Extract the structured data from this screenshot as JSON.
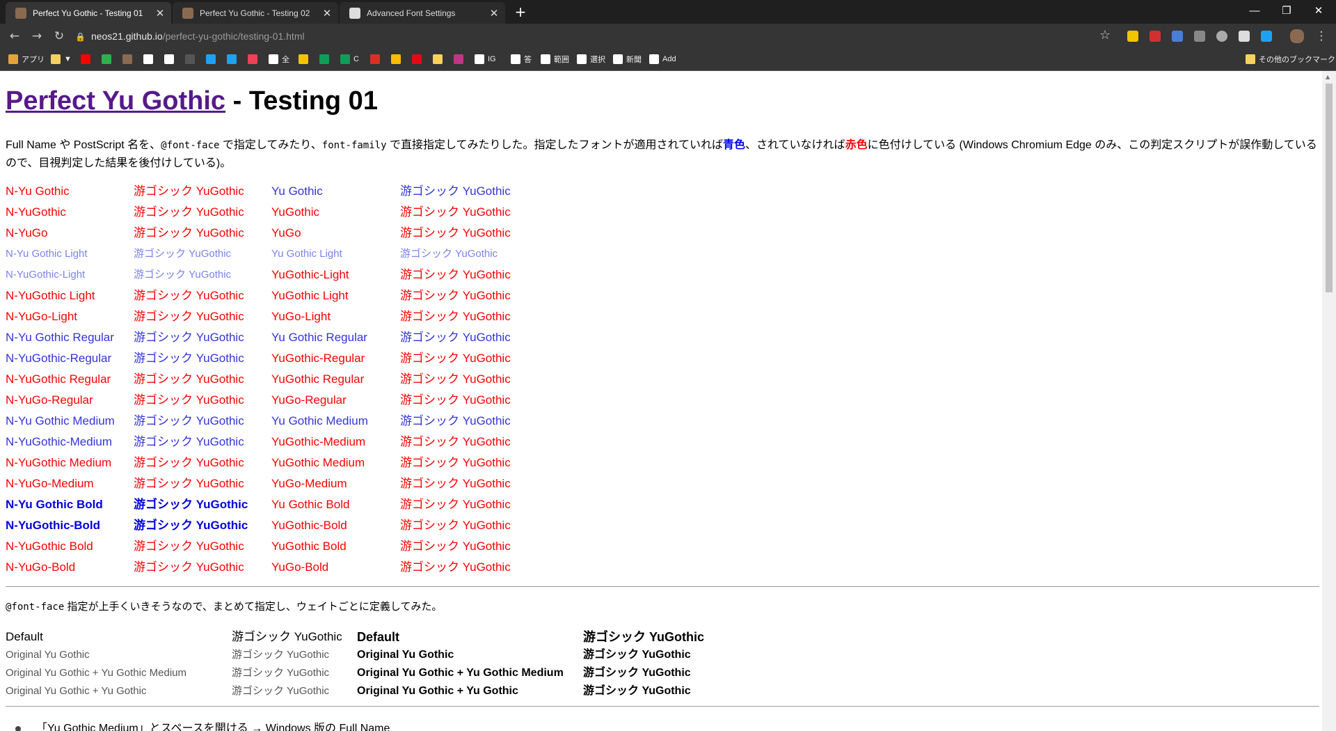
{
  "browser": {
    "tabs": [
      {
        "title": "Perfect Yu Gothic - Testing 01",
        "active": true
      },
      {
        "title": "Perfect Yu Gothic - Testing 02",
        "active": false
      },
      {
        "title": "Advanced Font Settings",
        "active": false
      }
    ],
    "new_tab": "+",
    "window_controls": {
      "minimize": "—",
      "restore": "❐",
      "close": "✕"
    },
    "nav": {
      "back": "←",
      "forward": "→",
      "reload": "↻"
    },
    "url_host": "neos21.github.io",
    "url_path": "/perfect-yu-gothic/testing-01.html",
    "bookmark_star": "☆",
    "bookmarks": [
      {
        "label": "アプリ",
        "icon": "apps-grid-icon",
        "color": "#e5a33b"
      },
      {
        "label": "▼",
        "icon": "folder-icon",
        "color": "#f6d25c"
      },
      {
        "label": "",
        "icon": "youtube-icon",
        "color": "#ff0000"
      },
      {
        "label": "",
        "icon": "feedly-icon",
        "color": "#2bb24c"
      },
      {
        "label": "",
        "icon": "photo-icon",
        "color": "#8a6a50"
      },
      {
        "label": "",
        "icon": "doc-icon",
        "color": "#ffffff"
      },
      {
        "label": "",
        "icon": "medium-icon",
        "color": "#ffffff"
      },
      {
        "label": "",
        "icon": "github-icon",
        "color": "#555555"
      },
      {
        "label": "",
        "icon": "twitter-icon",
        "color": "#1da1f2"
      },
      {
        "label": "",
        "icon": "twitter-icon",
        "color": "#1da1f2"
      },
      {
        "label": "",
        "icon": "pocket-icon",
        "color": "#ef4056"
      },
      {
        "label": "全",
        "icon": "globe-icon",
        "color": "#ffffff"
      },
      {
        "label": "",
        "icon": "note-icon",
        "color": "#f2c500"
      },
      {
        "label": "",
        "icon": "sheet-icon",
        "color": "#0f9d58"
      },
      {
        "label": "C",
        "icon": "sheet-icon",
        "color": "#0f9d58"
      },
      {
        "label": "",
        "icon": "gmail-icon",
        "color": "#d93025"
      },
      {
        "label": "",
        "icon": "drive-icon",
        "color": "#fbbc04"
      },
      {
        "label": "",
        "icon": "netflix-icon",
        "color": "#e50914"
      },
      {
        "label": "",
        "icon": "folder-icon",
        "color": "#f6d25c"
      },
      {
        "label": "",
        "icon": "instagram-icon",
        "color": "#c13584"
      },
      {
        "label": "IG",
        "icon": "globe-icon",
        "color": "#ffffff"
      },
      {
        "label": "答",
        "icon": "globe-icon",
        "color": "#ffffff"
      },
      {
        "label": "範囲",
        "icon": "globe-icon",
        "color": "#ffffff"
      },
      {
        "label": "選択",
        "icon": "globe-icon",
        "color": "#ffffff"
      },
      {
        "label": "新聞",
        "icon": "globe-icon",
        "color": "#ffffff"
      },
      {
        "label": "Add",
        "icon": "globe-icon",
        "color": "#ffffff"
      }
    ],
    "other_bookmarks": "その他のブックマーク"
  },
  "page": {
    "title_link": "Perfect Yu Gothic",
    "title_rest": " - Testing 01",
    "intro": {
      "p1": "Full Name や PostScript 名を、",
      "code1": "@font-face",
      "p2": " で指定してみたり、",
      "code2": "font-family",
      "p3": " で直接指定してみたりした。指定したフォントが適用されていれば",
      "blue": "青色",
      "p4": "、されていなければ",
      "red": "赤色",
      "p5": "に色付けしている (Windows Chromium Edge のみ、この判定スクリプトが誤作動しているので、目視判定した結果を後付けしている)。"
    },
    "rows": [
      {
        "c1": "N-Yu Gothic",
        "s1": "r",
        "c2": "游ゴシック YuGothic",
        "s2": "r",
        "c3": "Yu Gothic",
        "s3": "b",
        "c4": "游ゴシック YuGothic",
        "s4": "b"
      },
      {
        "c1": "N-YuGothic",
        "s1": "r",
        "c2": "游ゴシック YuGothic",
        "s2": "r",
        "c3": "YuGothic",
        "s3": "r",
        "c4": "游ゴシック YuGothic",
        "s4": "r"
      },
      {
        "c1": "N-YuGo",
        "s1": "r",
        "c2": "游ゴシック YuGothic",
        "s2": "r",
        "c3": "YuGo",
        "s3": "r",
        "c4": "游ゴシック YuGothic",
        "s4": "r"
      },
      {
        "c1": "N-Yu Gothic Light",
        "s1": "l",
        "c2": "游ゴシック YuGothic",
        "s2": "l",
        "c3": "Yu Gothic Light",
        "s3": "l",
        "c4": "游ゴシック YuGothic",
        "s4": "l"
      },
      {
        "c1": "N-YuGothic-Light",
        "s1": "l",
        "c2": "游ゴシック YuGothic",
        "s2": "l",
        "c3": "YuGothic-Light",
        "s3": "r",
        "c4": "游ゴシック YuGothic",
        "s4": "r"
      },
      {
        "c1": "N-YuGothic Light",
        "s1": "r",
        "c2": "游ゴシック YuGothic",
        "s2": "r",
        "c3": "YuGothic Light",
        "s3": "r",
        "c4": "游ゴシック YuGothic",
        "s4": "r"
      },
      {
        "c1": "N-YuGo-Light",
        "s1": "r",
        "c2": "游ゴシック YuGothic",
        "s2": "r",
        "c3": "YuGo-Light",
        "s3": "r",
        "c4": "游ゴシック YuGothic",
        "s4": "r"
      },
      {
        "c1": "N-Yu Gothic Regular",
        "s1": "b",
        "c2": "游ゴシック YuGothic",
        "s2": "b",
        "c3": "Yu Gothic Regular",
        "s3": "b",
        "c4": "游ゴシック YuGothic",
        "s4": "b"
      },
      {
        "c1": "N-YuGothic-Regular",
        "s1": "b",
        "c2": "游ゴシック YuGothic",
        "s2": "b",
        "c3": "YuGothic-Regular",
        "s3": "r",
        "c4": "游ゴシック YuGothic",
        "s4": "r"
      },
      {
        "c1": "N-YuGothic Regular",
        "s1": "r",
        "c2": "游ゴシック YuGothic",
        "s2": "r",
        "c3": "YuGothic Regular",
        "s3": "r",
        "c4": "游ゴシック YuGothic",
        "s4": "r"
      },
      {
        "c1": "N-YuGo-Regular",
        "s1": "r",
        "c2": "游ゴシック YuGothic",
        "s2": "r",
        "c3": "YuGo-Regular",
        "s3": "r",
        "c4": "游ゴシック YuGothic",
        "s4": "r"
      },
      {
        "c1": "N-Yu Gothic Medium",
        "s1": "b",
        "c2": "游ゴシック YuGothic",
        "s2": "b",
        "c3": "Yu Gothic Medium",
        "s3": "b",
        "c4": "游ゴシック YuGothic",
        "s4": "b"
      },
      {
        "c1": "N-YuGothic-Medium",
        "s1": "b",
        "c2": "游ゴシック YuGothic",
        "s2": "b",
        "c3": "YuGothic-Medium",
        "s3": "r",
        "c4": "游ゴシック YuGothic",
        "s4": "r"
      },
      {
        "c1": "N-YuGothic Medium",
        "s1": "r",
        "c2": "游ゴシック YuGothic",
        "s2": "r",
        "c3": "YuGothic Medium",
        "s3": "r",
        "c4": "游ゴシック YuGothic",
        "s4": "r"
      },
      {
        "c1": "N-YuGo-Medium",
        "s1": "r",
        "c2": "游ゴシック YuGothic",
        "s2": "r",
        "c3": "YuGo-Medium",
        "s3": "r",
        "c4": "游ゴシック YuGothic",
        "s4": "r"
      },
      {
        "c1": "N-Yu Gothic Bold",
        "s1": "bb",
        "c2": "游ゴシック YuGothic",
        "s2": "bb",
        "c3": "Yu Gothic Bold",
        "s3": "r",
        "c4": "游ゴシック YuGothic",
        "s4": "r"
      },
      {
        "c1": "N-YuGothic-Bold",
        "s1": "bb",
        "c2": "游ゴシック YuGothic",
        "s2": "bb",
        "c3": "YuGothic-Bold",
        "s3": "r",
        "c4": "游ゴシック YuGothic",
        "s4": "r"
      },
      {
        "c1": "N-YuGothic Bold",
        "s1": "r",
        "c2": "游ゴシック YuGothic",
        "s2": "r",
        "c3": "YuGothic Bold",
        "s3": "r",
        "c4": "游ゴシック YuGothic",
        "s4": "r"
      },
      {
        "c1": "N-YuGo-Bold",
        "s1": "r",
        "c2": "游ゴシック YuGothic",
        "s2": "r",
        "c3": "YuGo-Bold",
        "s3": "r",
        "c4": "游ゴシック YuGothic",
        "s4": "r"
      }
    ],
    "note_code": "@font-face",
    "note_text": " 指定が上手くいきそうなので、まとめて指定し、ウェイトごとに定義してみた。",
    "weights": [
      {
        "a": "Default",
        "b": "游ゴシック YuGothic",
        "c": "Default",
        "d": "游ゴシック YuGothic"
      },
      {
        "a": "Original Yu Gothic",
        "b": "游ゴシック YuGothic",
        "c": "Original Yu Gothic",
        "d": "游ゴシック YuGothic"
      },
      {
        "a": "Original Yu Gothic + Yu Gothic Medium",
        "b": "游ゴシック YuGothic",
        "c": "Original Yu Gothic + Yu Gothic Medium",
        "d": "游ゴシック YuGothic"
      },
      {
        "a": "Original Yu Gothic + Yu Gothic",
        "b": "游ゴシック YuGothic",
        "c": "Original Yu Gothic + Yu Gothic",
        "d": "游ゴシック YuGothic"
      }
    ],
    "bottom_item": "「Yu Gothic Medium」とスペースを開ける → Windows 版の Full Name"
  },
  "colors": {
    "applied": "#0000ff",
    "not_applied": "#ff0000",
    "link_visited": "#551a8b"
  }
}
